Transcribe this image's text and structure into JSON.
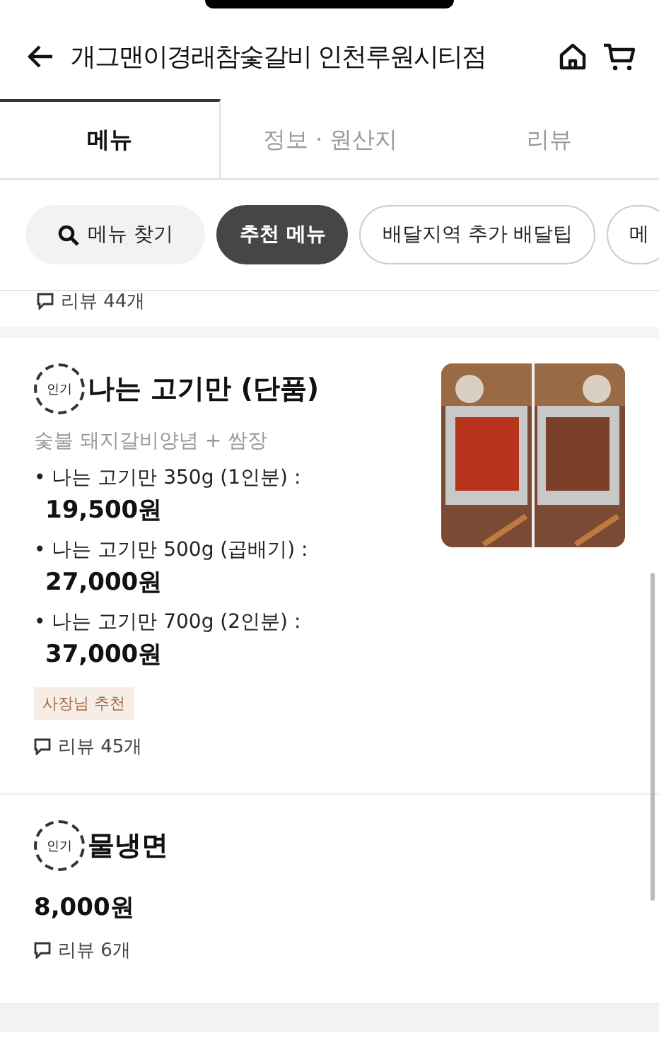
{
  "header": {
    "title": "개그맨이경래참숯갈비 인천루원시티점"
  },
  "tabs": [
    {
      "label": "메뉴",
      "selected": true
    },
    {
      "label": "정보 · 원산지",
      "selected": false
    },
    {
      "label": "리뷰",
      "selected": false
    }
  ],
  "chips": [
    {
      "kind": "search",
      "label": "메뉴 찾기",
      "selected": false
    },
    {
      "kind": "chip",
      "label": "추천 메뉴",
      "selected": true
    },
    {
      "kind": "chip",
      "label": "배달지역 추가 배달팁",
      "selected": false
    },
    {
      "kind": "chip",
      "label": "메",
      "selected": false
    }
  ],
  "prev_review": "리뷰 44개",
  "items": [
    {
      "badge": "인기",
      "name": "나는 고기만 (단품)",
      "description": "숯불 돼지갈비양념 + 쌈장",
      "options": [
        {
          "label": "• 나는 고기만  350g (1인분) :",
          "price": "19,500원"
        },
        {
          "label": "• 나는 고기만 500g (곱배기) :",
          "price": "27,000원"
        },
        {
          "label": "• 나는 고기만 700g (2인분) :",
          "price": "37,000원"
        }
      ],
      "tag": "사장님 추천",
      "review": "리뷰 45개",
      "image": {
        "kind": "picture"
      }
    },
    {
      "badge": "인기",
      "name": "물냉면",
      "price": "8,000원",
      "review": "리뷰 6개"
    }
  ]
}
